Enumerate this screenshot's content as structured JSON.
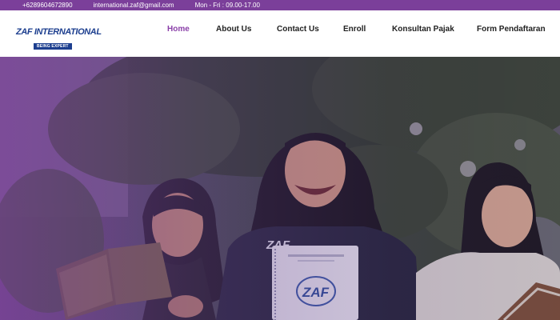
{
  "topbar": {
    "phone": "+6289604672890",
    "email": "international.zaf@gmail.com",
    "hours": "Mon - Fri : 09.00-17.00"
  },
  "logo": {
    "name": "ZAF INTERNATIONAL",
    "tagline": "BEING EXPERT"
  },
  "nav": {
    "items": [
      {
        "label": "Home",
        "active": true
      },
      {
        "label": "About Us",
        "active": false
      },
      {
        "label": "Contact Us",
        "active": false
      },
      {
        "label": "Enroll",
        "active": false
      },
      {
        "label": "Konsultan Pajak",
        "active": false
      },
      {
        "label": "Form Pendaftaran",
        "active": false
      }
    ]
  },
  "hero": {
    "shirt_logo": "ZAF",
    "booklet_logo": "ZAF"
  },
  "colors": {
    "brand_purple": "#7b3f9a",
    "active_nav": "#8a3fa8",
    "logo_blue": "#1d3f8f"
  }
}
